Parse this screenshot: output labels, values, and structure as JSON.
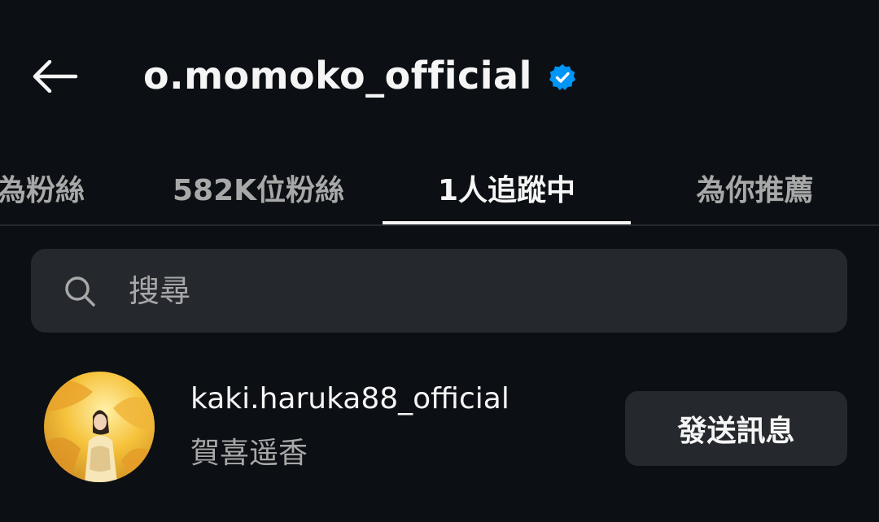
{
  "header": {
    "back_icon": "arrow-left-icon",
    "title": "o.momoko_official",
    "verified_icon": "verified-badge-icon",
    "verified_color": "#0095f6"
  },
  "tabs": [
    {
      "label": "同為粉絲"
    },
    {
      "label": "582K位粉絲"
    },
    {
      "label": "1人追蹤中",
      "active": true
    },
    {
      "label": "為你推薦"
    }
  ],
  "search": {
    "icon": "search-icon",
    "placeholder": "搜尋",
    "value": ""
  },
  "following": [
    {
      "username": "kaki.haruka88_official",
      "full_name": "賀喜遥香",
      "avatar": "avatar-photo",
      "button_label": "發送訊息"
    }
  ],
  "colors": {
    "background": "#0c1014",
    "surface": "#25292e",
    "text_primary": "#f5f5f5",
    "text_secondary": "#a8a8a8",
    "accent": "#0095f6"
  }
}
